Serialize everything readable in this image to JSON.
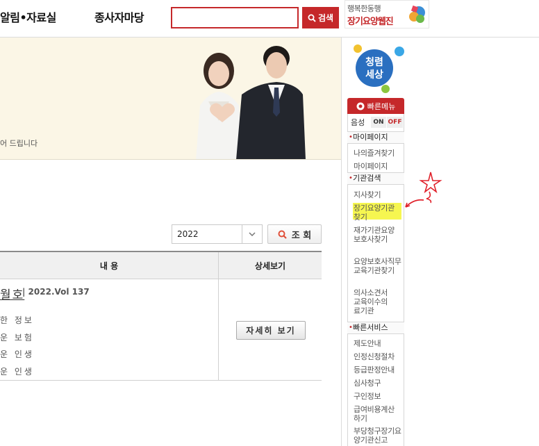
{
  "header": {
    "nav_alrim": "알림•자료실",
    "nav_jongsa": "종사자마당",
    "search": {
      "placeholder": "",
      "button_label": "검색"
    },
    "banner": {
      "line1": "행복한동행",
      "line2": "장기요양웹진"
    }
  },
  "visual": {
    "caption": "어 드립니다"
  },
  "filter": {
    "year": "2022",
    "search_label": "조 회"
  },
  "table": {
    "headers": {
      "content": "내 용",
      "detail": "상세보기"
    },
    "row": {
      "title": "월호",
      "volume": "| 2022.Vol 137",
      "articles": [
        "한 정보",
        "운 보험",
        "운 인생",
        "운 인생"
      ],
      "detail_button": "자세히 보기"
    }
  },
  "sidebar": {
    "quick_menu": "빠른메뉴",
    "voice": {
      "label": "음성",
      "on": "ON",
      "off": "OFF"
    },
    "sections": [
      {
        "title": "마이페이지",
        "items": [
          "나의즐겨찾기",
          "마이페이지"
        ]
      },
      {
        "title": "기관검색",
        "items": [
          "지사찾기",
          "장기요양기관찾기",
          "재가기관요양보호사찾기",
          "요양보호사직무교육기관찾기",
          "의사소견서교육이수의료기관"
        ]
      },
      {
        "title": "빠른서비스",
        "items": [
          "제도안내",
          "인정신청절차",
          "등급판정안내",
          "심사청구",
          "구인정보",
          "급여비용계산하기",
          "부당청구장기요양기관신고"
        ]
      }
    ]
  },
  "colors": {
    "accent": "#c5282a",
    "highlight": "#f6f650",
    "visual_bg": "#fbf6e6"
  }
}
